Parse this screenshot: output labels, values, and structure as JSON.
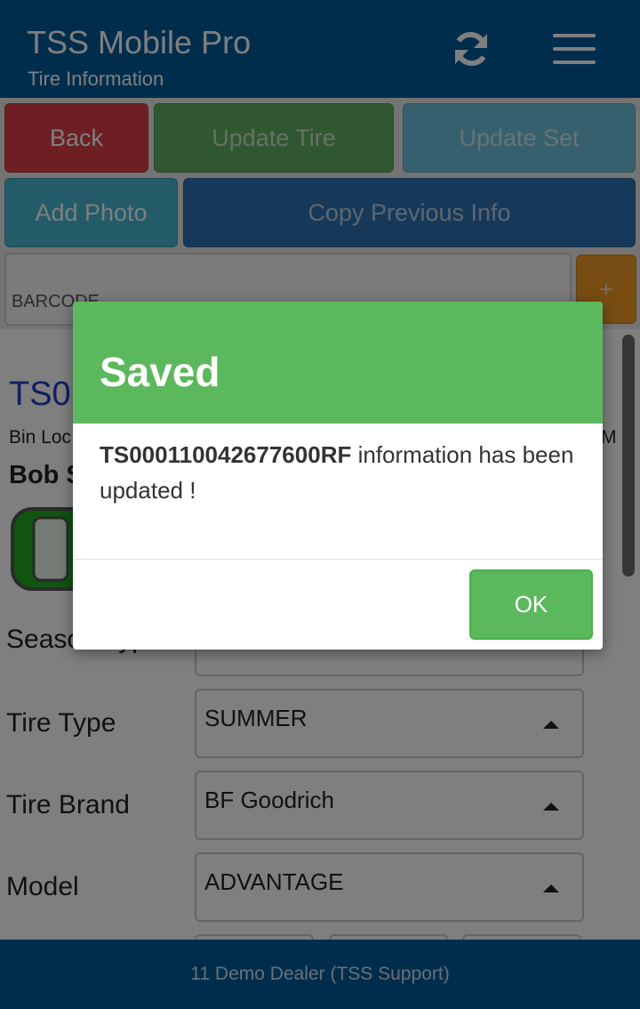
{
  "app": {
    "title": "TSS Mobile Pro",
    "subtitle": "Tire Information",
    "refresh_icon": "refresh-icon",
    "menu_icon": "hamburger-menu-icon"
  },
  "toolbar": {
    "back_label": "Back",
    "update_tire_label": "Update Tire",
    "update_set_label": "Update Set",
    "add_photo_label": "Add Photo",
    "copy_previous_label": "Copy Previous Info"
  },
  "barcode": {
    "placeholder": "BARCODE",
    "value": "",
    "add_label": "+"
  },
  "tire": {
    "id_partial": "TS0",
    "bin_location_partial": "Bin Loc",
    "bin_location_right_partial": "M",
    "owner_partial": "Bob S"
  },
  "fields": {
    "season_type_label": "Season Type",
    "tire_type_label": "Tire Type",
    "tire_type_value": "SUMMER",
    "tire_brand_label": "Tire Brand",
    "tire_brand_value": "BF Goodrich",
    "model_label": "Model",
    "model_value": "ADVANTAGE"
  },
  "footer": {
    "dealer": "11 Demo Dealer (TSS Support)"
  },
  "dialog": {
    "title": "Saved",
    "message_id": "TS000110042677600RF",
    "message_text": " information has been updated !",
    "ok_label": "OK"
  },
  "colors": {
    "header_bg": "#035a9b",
    "back_btn": "#dc3f46",
    "update_btn": "#62ae62",
    "info_btn": "#47b7d3",
    "primary_btn": "#2f73b3",
    "warning_btn": "#ef9a26",
    "success": "#5cb85c"
  }
}
